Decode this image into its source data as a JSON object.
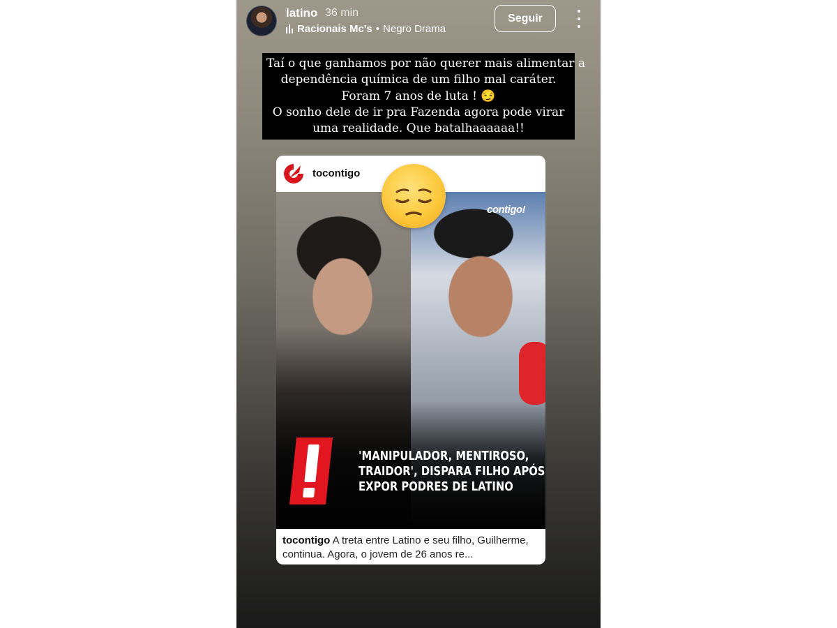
{
  "header": {
    "username": "latino",
    "time": "36 min",
    "music_artist": "Racionais Mc's",
    "music_separator": "•",
    "music_track": "Negro Drama",
    "follow_label": "Seguir"
  },
  "caption_lines": [
    "Taí o que ganhamos por não querer mais alimentar a",
    "dependência química de um filho mal caráter.",
    "Foram 7 anos de luta ! 😏",
    "O sonho dele de ir pra Fazenda agora pode virar",
    "uma realidade. Que batalhaaaaaa!!"
  ],
  "post": {
    "account": "tocontigo",
    "watermark": "contigo!",
    "sticker_emoji": "pensive-face",
    "headline_lines": [
      "'Manipulador, mentiroso,",
      "traidor', dispara filho após",
      "expor podres de Latino"
    ],
    "caption_account": "tocontigo",
    "caption_text": "A treta entre Latino e seu filho, Guilherme, continua. Agora, o jovem de 26 anos re..."
  },
  "colors": {
    "brand_red": "#e1161f",
    "follow_border": "#ffffff"
  }
}
